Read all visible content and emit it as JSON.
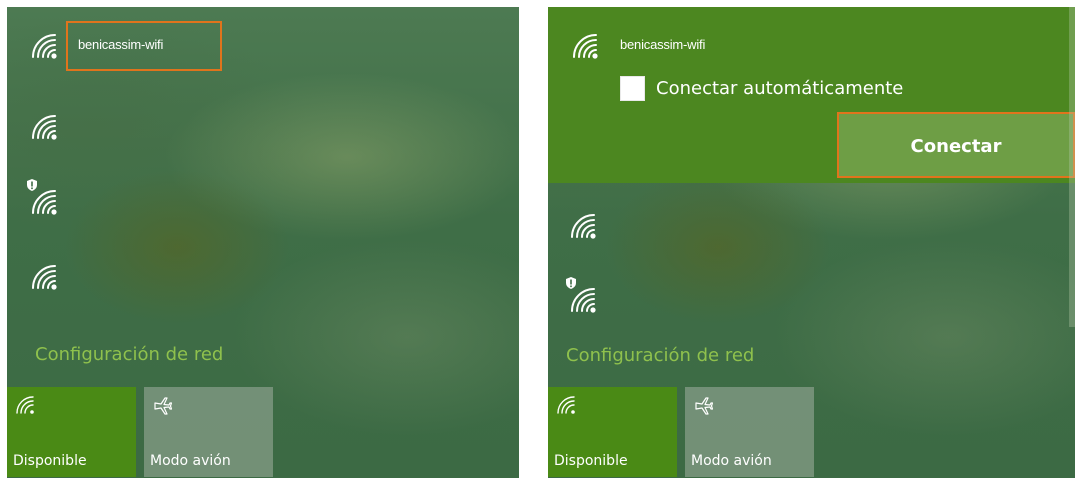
{
  "left_panel": {
    "networks": [
      {
        "name": "benicassim-wifi",
        "icon": "wifi-signal-icon",
        "highlighted": true
      },
      {
        "name": "",
        "icon": "wifi-signal-icon"
      },
      {
        "name": "",
        "icon": "wifi-signal-icon",
        "secured_warning": true
      },
      {
        "name": "",
        "icon": "wifi-signal-icon"
      }
    ],
    "network_settings_label": "Configuración de red",
    "tiles": [
      {
        "label": "Disponible",
        "icon": "wifi-icon",
        "active": true
      },
      {
        "label": "Modo avión",
        "icon": "airplane-icon",
        "active": false
      }
    ]
  },
  "right_panel": {
    "selected_network": {
      "name": "benicassim-wifi",
      "auto_connect_label": "Conectar automáticamente",
      "auto_connect_checked": false,
      "connect_button_label": "Conectar"
    },
    "network_settings_label": "Configuración de red",
    "tiles": [
      {
        "label": "Disponible",
        "icon": "wifi-icon",
        "active": true
      },
      {
        "label": "Modo avión",
        "icon": "airplane-icon",
        "active": false
      }
    ]
  },
  "colors": {
    "accent_green": "#4a8a15",
    "highlight_orange": "#e0741c",
    "link_green": "#8fc14d"
  }
}
